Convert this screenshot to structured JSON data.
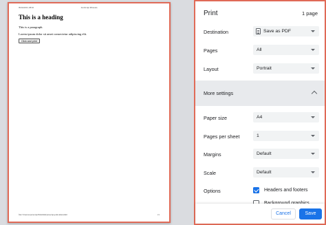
{
  "preview": {
    "header_left": "09/04/2023, 08:02",
    "header_center": "JavaScript Printouts",
    "heading": "This is a heading",
    "paragraph1": "This is a paragraph.",
    "paragraph2": "Lorem ipsum dolor sit amet consectetur adipiscing elit.",
    "button_label": "Click and print",
    "footer_left": "file:///Users/ss/javascript/Print/html/javascript-print-index.html",
    "footer_right": "1/1"
  },
  "dialog": {
    "title": "Print",
    "page_count": "1 page",
    "destination": {
      "label": "Destination",
      "value": "Save as PDF",
      "icon": "pdf-file-icon"
    },
    "pages": {
      "label": "Pages",
      "value": "All"
    },
    "layout": {
      "label": "Layout",
      "value": "Portrait"
    },
    "more_settings": {
      "label": "More settings",
      "icon": "chevron-up-icon"
    },
    "paper_size": {
      "label": "Paper size",
      "value": "A4"
    },
    "pages_per_sheet": {
      "label": "Pages per sheet",
      "value": "1"
    },
    "margins": {
      "label": "Margins",
      "value": "Default"
    },
    "scale": {
      "label": "Scale",
      "value": "Default"
    },
    "options": {
      "label": "Options",
      "headers_footers": {
        "label": "Headers and footers",
        "checked": true
      },
      "background_graphics": {
        "label": "Background graphics",
        "checked": false
      }
    },
    "cancel_label": "Cancel",
    "save_label": "Save"
  },
  "colors": {
    "accent": "#1a73e8",
    "highlight_border": "#e06a57",
    "preview_bg": "#dadce0"
  }
}
